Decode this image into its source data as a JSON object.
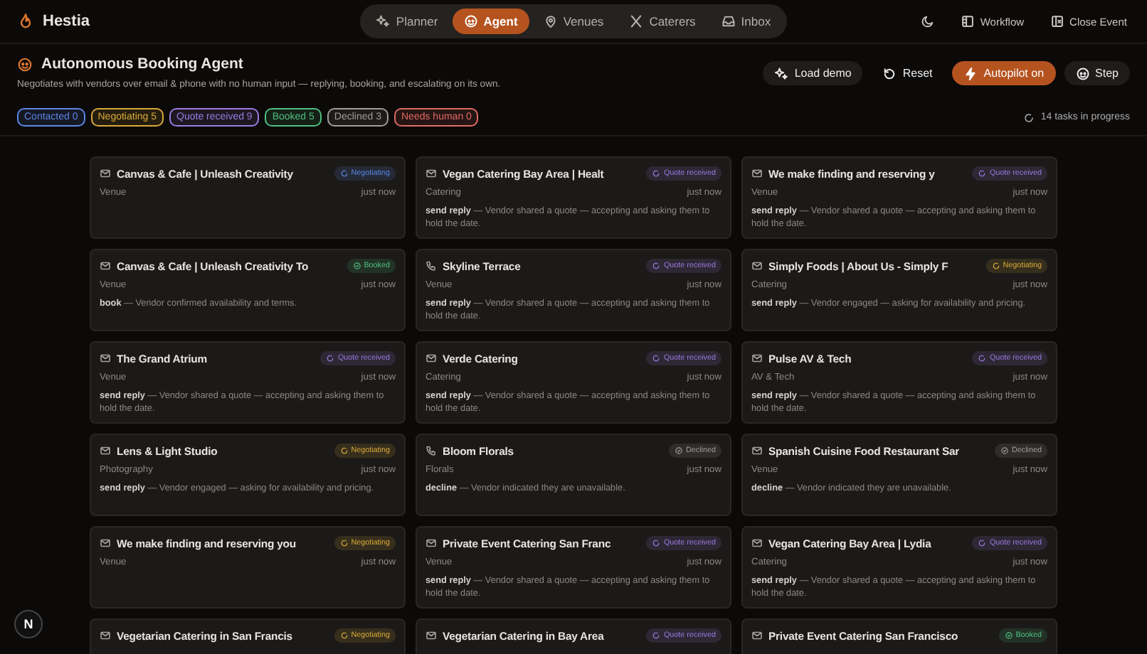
{
  "app": {
    "title": "Hestia"
  },
  "nav": [
    {
      "label": "Planner",
      "selected": false
    },
    {
      "label": "Agent",
      "selected": true
    },
    {
      "label": "Venues",
      "selected": false
    },
    {
      "label": "Caterers",
      "selected": false
    },
    {
      "label": "Inbox",
      "selected": false
    }
  ],
  "header_actions": [
    "Workflow",
    "Close Event"
  ],
  "agent": {
    "title": "Autonomous Booking Agent",
    "subtitle": "Negotiates with vendors over email & phone with no human input — replying, booking, and escalating on its own.",
    "buttons": [
      {
        "label": "Load demo",
        "kind": "plain"
      },
      {
        "label": "Reset",
        "kind": "ghost"
      },
      {
        "label": "Autopilot on",
        "kind": "primary"
      },
      {
        "label": "Step",
        "kind": "plain"
      }
    ],
    "counters": [
      {
        "label": "Contacted",
        "count": "0",
        "color": "#5b86e5"
      },
      {
        "label": "Negotiating",
        "count": "5",
        "color": "#d9a93a"
      },
      {
        "label": "Quote received",
        "count": "9",
        "color": "#9b7be0"
      },
      {
        "label": "Booked",
        "count": "5",
        "color": "#4fbf7f"
      },
      {
        "label": "Declined",
        "count": "3",
        "color": "#a19d99"
      },
      {
        "label": "Needs human",
        "count": "0",
        "color": "#e06a64"
      }
    ],
    "progress": "14 tasks in progress"
  },
  "tasks": [
    {
      "kind": "email",
      "title": "Canvas & Cafe | Unleash Creativity",
      "status": {
        "label": "Negotiating",
        "kind": "spinner"
      },
      "color": "#5b86e5",
      "category": "Venue",
      "time": "just now"
    },
    {
      "kind": "email",
      "title": "Vegan Catering Bay Area | Healt",
      "status": {
        "label": "Quote received",
        "kind": "spinner"
      },
      "color": "#9b7be0",
      "category": "Catering",
      "time": "just now",
      "action": "send reply",
      "note": "— Vendor shared a quote — accepting and asking them to hold the date."
    },
    {
      "kind": "email",
      "title": "We make finding and reserving y",
      "status": {
        "label": "Quote received",
        "kind": "spinner"
      },
      "color": "#9b7be0",
      "category": "Venue",
      "time": "just now",
      "action": "send reply",
      "note": "— Vendor shared a quote — accepting and asking them to hold the date."
    },
    {
      "kind": "email",
      "title": "Canvas & Cafe | Unleash Creativity To",
      "status": {
        "label": "Booked",
        "kind": "check"
      },
      "color": "#4fbf7f",
      "category": "Venue",
      "time": "just now",
      "action": "book",
      "note": "— Vendor confirmed availability and terms."
    },
    {
      "kind": "phone",
      "title": "Skyline Terrace",
      "status": {
        "label": "Quote received",
        "kind": "spinner"
      },
      "color": "#9b7be0",
      "category": "Venue",
      "time": "just now",
      "action": "send reply",
      "note": "— Vendor shared a quote — accepting and asking them to hold the date."
    },
    {
      "kind": "email",
      "title": "Simply Foods | About Us - Simply F",
      "status": {
        "label": "Negotiating",
        "kind": "spinner"
      },
      "color": "#d9a93a",
      "category": "Catering",
      "time": "just now",
      "action": "send reply",
      "note": "— Vendor engaged — asking for availability and pricing."
    },
    {
      "kind": "email",
      "title": "The Grand Atrium",
      "status": {
        "label": "Quote received",
        "kind": "spinner"
      },
      "color": "#9b7be0",
      "category": "Venue",
      "time": "just now",
      "action": "send reply",
      "note": "— Vendor shared a quote — accepting and asking them to hold the date."
    },
    {
      "kind": "email",
      "title": "Verde Catering",
      "status": {
        "label": "Quote received",
        "kind": "spinner"
      },
      "color": "#9b7be0",
      "category": "Catering",
      "time": "just now",
      "action": "send reply",
      "note": "— Vendor shared a quote — accepting and asking them to hold the date."
    },
    {
      "kind": "email",
      "title": "Pulse AV & Tech",
      "status": {
        "label": "Quote received",
        "kind": "spinner"
      },
      "color": "#9b7be0",
      "category": "AV & Tech",
      "time": "just now",
      "action": "send reply",
      "note": "— Vendor shared a quote — accepting and asking them to hold the date."
    },
    {
      "kind": "email",
      "title": "Lens & Light Studio",
      "status": {
        "label": "Negotiating",
        "kind": "spinner"
      },
      "color": "#d9a93a",
      "category": "Photography",
      "time": "just now",
      "action": "send reply",
      "note": "— Vendor engaged — asking for availability and pricing."
    },
    {
      "kind": "phone",
      "title": "Bloom Florals",
      "status": {
        "label": "Declined",
        "kind": "check"
      },
      "color": "#a19d99",
      "category": "Florals",
      "time": "just now",
      "action": "decline",
      "note": "— Vendor indicated they are unavailable."
    },
    {
      "kind": "email",
      "title": "Spanish Cuisine Food Restaurant Sar",
      "status": {
        "label": "Declined",
        "kind": "check"
      },
      "color": "#a19d99",
      "category": "Venue",
      "time": "just now",
      "action": "decline",
      "note": "— Vendor indicated they are unavailable."
    },
    {
      "kind": "email",
      "title": "We make finding and reserving you",
      "status": {
        "label": "Negotiating",
        "kind": "spinner"
      },
      "color": "#d9a93a",
      "category": "Venue",
      "time": "just now"
    },
    {
      "kind": "email",
      "title": "Private Event Catering San Franc",
      "status": {
        "label": "Quote received",
        "kind": "spinner"
      },
      "color": "#9b7be0",
      "category": "Venue",
      "time": "just now",
      "action": "send reply",
      "note": "— Vendor shared a quote — accepting and asking them to hold the date."
    },
    {
      "kind": "email",
      "title": "Vegan Catering Bay Area | Lydia",
      "status": {
        "label": "Quote received",
        "kind": "spinner"
      },
      "color": "#9b7be0",
      "category": "Catering",
      "time": "just now",
      "action": "send reply",
      "note": "— Vendor shared a quote — accepting and asking them to hold the date."
    },
    {
      "kind": "email",
      "title": "Vegetarian Catering in San Francis",
      "status": {
        "label": "Negotiating",
        "kind": "spinner"
      },
      "color": "#d9a93a"
    },
    {
      "kind": "email",
      "title": "Vegetarian Catering in Bay Area",
      "status": {
        "label": "Quote received",
        "kind": "spinner"
      },
      "color": "#9b7be0"
    },
    {
      "kind": "email",
      "title": "Private Event Catering San Francisco",
      "status": {
        "label": "Booked",
        "kind": "check"
      },
      "color": "#4fbf7f"
    }
  ],
  "dev_badge": "N"
}
